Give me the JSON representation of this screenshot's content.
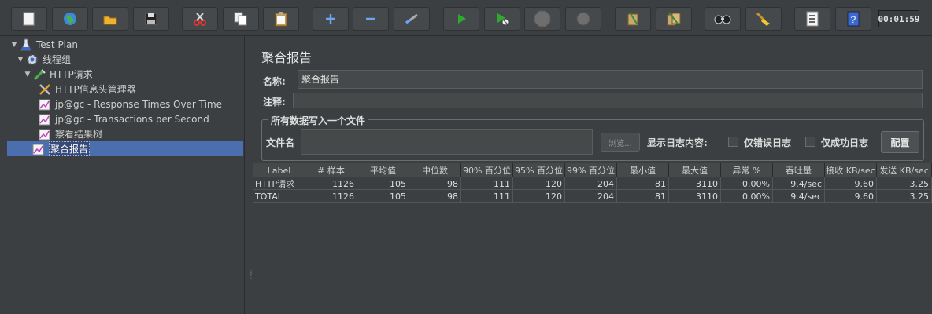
{
  "toolbar": {
    "buttons": [
      {
        "name": "new-icon"
      },
      {
        "name": "templates-icon"
      },
      {
        "name": "open-icon"
      },
      {
        "name": "save-icon"
      },
      {
        "name": "cut-icon"
      },
      {
        "name": "copy-icon"
      },
      {
        "name": "paste-icon"
      },
      {
        "name": "expand-icon"
      },
      {
        "name": "collapse-icon"
      },
      {
        "name": "toggle-icon"
      },
      {
        "name": "start-icon"
      },
      {
        "name": "start-no-pause-icon"
      },
      {
        "name": "stop-icon"
      },
      {
        "name": "shutdown-icon"
      },
      {
        "name": "clear-icon"
      },
      {
        "name": "clear-all-icon"
      },
      {
        "name": "search-icon"
      },
      {
        "name": "reset-search-icon"
      },
      {
        "name": "function-helper-icon"
      },
      {
        "name": "help-icon"
      }
    ],
    "timer": "00:01:59",
    "colors": {
      "start": "#2fa82f",
      "cut": "#d33"
    }
  },
  "tree": {
    "items": [
      {
        "label": "Test Plan",
        "icon": "test-plan-icon",
        "expanded": true
      },
      {
        "label": "线程组",
        "icon": "gear-icon",
        "expanded": true
      },
      {
        "label": "HTTP请求",
        "icon": "sampler-icon",
        "expanded": true
      },
      {
        "label": "HTTP信息头管理器",
        "icon": "tools-icon"
      },
      {
        "label": "jp@gc - Response Times Over Time",
        "icon": "graph-icon"
      },
      {
        "label": "jp@gc - Transactions per Second",
        "icon": "graph-icon"
      },
      {
        "label": "察看结果树",
        "icon": "graph-icon"
      },
      {
        "label": "聚合报告",
        "icon": "graph-icon",
        "selected": true
      }
    ]
  },
  "panel": {
    "title": "聚合报告",
    "name_label": "名称:",
    "name_value": "聚合报告",
    "comment_label": "注释:",
    "comment_value": "",
    "file_group_title": "所有数据写入一个文件",
    "filename_label": "文件名",
    "filename_value": "",
    "browse_label": "浏览...",
    "log_content_label": "显示日志内容:",
    "errors_only_label": "仅错误日志",
    "success_only_label": "仅成功日志",
    "configure_label": "配置"
  },
  "table": {
    "headers": [
      "Label",
      "# 样本",
      "平均值",
      "中位数",
      "90% 百分位",
      "95% 百分位",
      "99% 百分位",
      "最小值",
      "最大值",
      "异常 %",
      "吞吐量",
      "接收 KB/sec",
      "发送 KB/sec"
    ],
    "rows": [
      [
        "HTTP请求",
        "1126",
        "105",
        "98",
        "111",
        "120",
        "204",
        "81",
        "3110",
        "0.00%",
        "9.4/sec",
        "9.60",
        "3.25"
      ],
      [
        "TOTAL",
        "1126",
        "105",
        "98",
        "111",
        "120",
        "204",
        "81",
        "3110",
        "0.00%",
        "9.4/sec",
        "9.60",
        "3.25"
      ]
    ]
  }
}
